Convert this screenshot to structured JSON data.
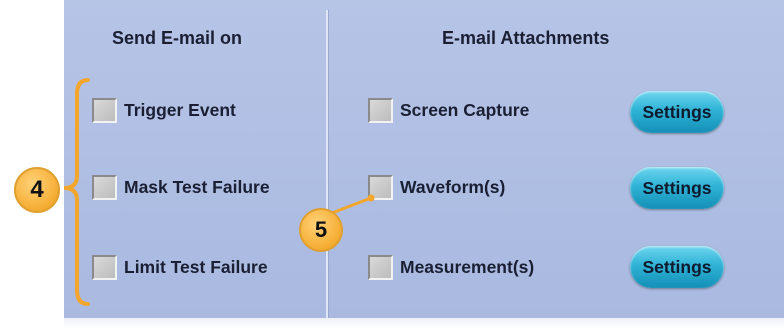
{
  "send_on": {
    "title": "Send E-mail on",
    "items": [
      {
        "label": "Trigger Event",
        "checked": false
      },
      {
        "label": "Mask Test Failure",
        "checked": false
      },
      {
        "label": "Limit Test Failure",
        "checked": false
      }
    ]
  },
  "attachments": {
    "title": "E-mail Attachments",
    "items": [
      {
        "label": "Screen Capture",
        "checked": false,
        "button": "Settings"
      },
      {
        "label": "Waveform(s)",
        "checked": false,
        "button": "Settings"
      },
      {
        "label": "Measurement(s)",
        "checked": false,
        "button": "Settings"
      }
    ]
  },
  "callouts": {
    "group_marker": "4",
    "checkbox_marker": "5"
  },
  "colors": {
    "panel": "#b0c0e4",
    "accent_button": "#2fb3d6",
    "callout": "#f7b23c"
  }
}
